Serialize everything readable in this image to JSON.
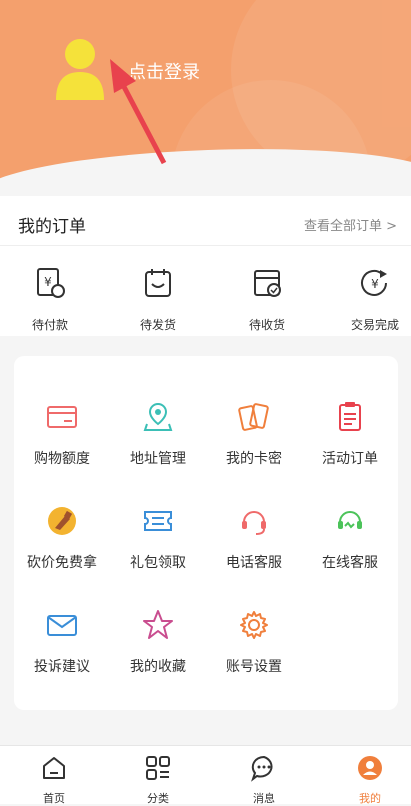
{
  "header": {
    "login_text": "点击登录"
  },
  "orders": {
    "title": "我的订单",
    "view_all": "查看全部订单 >",
    "items": [
      {
        "label": "待付款",
        "icon": "wallet-pending-icon"
      },
      {
        "label": "待发货",
        "icon": "package-ship-icon"
      },
      {
        "label": "待收货",
        "icon": "box-receive-icon"
      },
      {
        "label": "交易完成",
        "icon": "transaction-complete-icon"
      }
    ]
  },
  "services": [
    {
      "label": "购物额度",
      "icon": "card-icon",
      "color": "#ef6a6a"
    },
    {
      "label": "地址管理",
      "icon": "location-icon",
      "color": "#3bbfb6"
    },
    {
      "label": "我的卡密",
      "icon": "cards-icon",
      "color": "#f07f3c"
    },
    {
      "label": "活动订单",
      "icon": "clipboard-icon",
      "color": "#e8424d"
    },
    {
      "label": "砍价免费拿",
      "icon": "bargain-icon",
      "color": "#f3b330"
    },
    {
      "label": "礼包领取",
      "icon": "ticket-icon",
      "color": "#3a8ed8"
    },
    {
      "label": "电话客服",
      "icon": "headset-icon",
      "color": "#ef6a6a"
    },
    {
      "label": "在线客服",
      "icon": "online-headset-icon",
      "color": "#4cc35a"
    },
    {
      "label": "投诉建议",
      "icon": "mail-icon",
      "color": "#3a8ed8"
    },
    {
      "label": "我的收藏",
      "icon": "star-icon",
      "color": "#c94d8f"
    },
    {
      "label": "账号设置",
      "icon": "gear-icon",
      "color": "#f07f3c"
    }
  ],
  "tabbar": [
    {
      "label": "首页",
      "icon": "home-icon"
    },
    {
      "label": "分类",
      "icon": "category-icon"
    },
    {
      "label": "消息",
      "icon": "message-icon"
    },
    {
      "label": "我的",
      "icon": "profile-icon",
      "active": true
    }
  ],
  "colors": {
    "header": "#f4a06d",
    "accent": "#f07f3c",
    "avatar": "#f5e23a",
    "arrow": "#e8424d"
  }
}
